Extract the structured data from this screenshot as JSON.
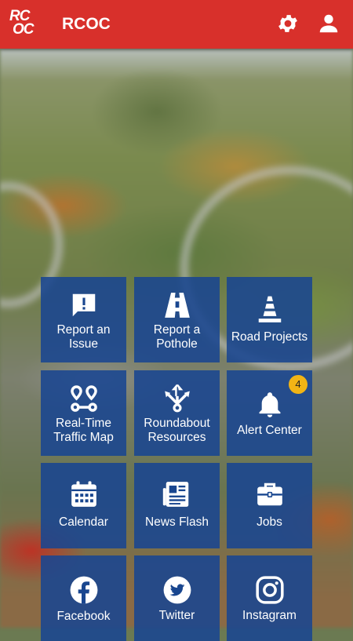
{
  "app": {
    "logo_line1": "RC",
    "logo_line2": "OC",
    "title": "RCOC"
  },
  "header": {
    "settings_icon": "gear-icon",
    "profile_icon": "person-icon"
  },
  "tiles": [
    {
      "label_line1": "Report an",
      "label_line2": "Issue",
      "icon": "alert-message-icon"
    },
    {
      "label_line1": "Report a",
      "label_line2": "Pothole",
      "icon": "road-icon"
    },
    {
      "label_line1": "Road Projects",
      "label_line2": "",
      "icon": "traffic-cone-icon"
    },
    {
      "label_line1": "Real-Time",
      "label_line2": "Traffic Map",
      "icon": "route-pins-icon"
    },
    {
      "label_line1": "Roundabout",
      "label_line2": "Resources",
      "icon": "roundabout-arrows-icon"
    },
    {
      "label_line1": "Alert Center",
      "label_line2": "",
      "icon": "bell-icon",
      "badge": "4"
    },
    {
      "label_line1": "Calendar",
      "label_line2": "",
      "icon": "calendar-icon"
    },
    {
      "label_line1": "News Flash",
      "label_line2": "",
      "icon": "newspaper-icon"
    },
    {
      "label_line1": "Jobs",
      "label_line2": "",
      "icon": "briefcase-icon"
    },
    {
      "label_line1": "Facebook",
      "label_line2": "",
      "icon": "facebook-icon"
    },
    {
      "label_line1": "Twitter",
      "label_line2": "",
      "icon": "twitter-icon"
    },
    {
      "label_line1": "Instagram",
      "label_line2": "",
      "icon": "instagram-icon"
    }
  ],
  "colors": {
    "appbar": "#d8302b",
    "tile": "#19468f",
    "badge": "#f2b415"
  }
}
